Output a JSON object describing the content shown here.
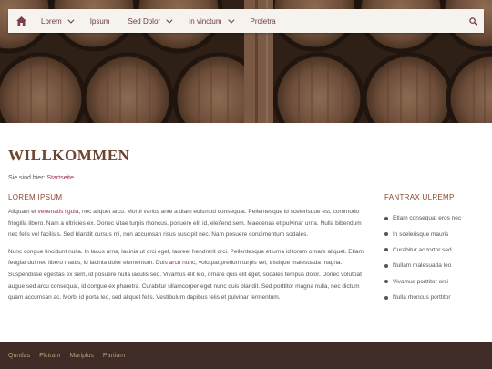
{
  "nav": {
    "items": [
      {
        "label": "Lorem",
        "has_dropdown": true
      },
      {
        "label": "Ipsum",
        "has_dropdown": false
      },
      {
        "label": "Sed Dolor",
        "has_dropdown": true
      },
      {
        "label": "In vinctum",
        "has_dropdown": true
      },
      {
        "label": "Proletra",
        "has_dropdown": false
      }
    ],
    "home_icon": "home-icon",
    "search_icon": "search-icon"
  },
  "page": {
    "title": "WILLKOMMEN",
    "breadcrumb_prefix": "Sie sind hier:",
    "breadcrumb_link": "Startseite"
  },
  "main": {
    "heading": "LOREM IPSUM",
    "p1": {
      "t1": "Aliquam et ",
      "link": "venenatis ligula",
      "t2": ", nec aliquet arcu. Morbi varius ante a diam euismod consequat. Pellentesque id scelerisque est, commodo fringilla libero. Nam a ultricies ex. Donec vitae turpis rhoncus, posuere elit id, eleifend sem. Maecenas et pulvinar urna. Nulla bibendum nec felis vel facilisis. Sed blandit cursus mi, non accumsan risus suscipit nec. Nam posuere condimentum sodales."
    },
    "p2": {
      "t1": "Nunc congue tincidunt nulla. In lacus urna, lacinia ut orci eget, laoreet hendrerit orci. Pellentesque et urna id lorem ornare aliquet. Etiam feugiat dui nec libero mattis, id lacinia dolor elementum. Duis ",
      "link": "arcu nunc",
      "t2": ", volutpat pretium turpis vel, tristique malesuada magna. Suspendisse egestas ex sem, id posuere nulla iaculis sed. Vivamus elit leo, ornare quis elit eget, sodales tempus dolor. Donec volutpat augue sed arcu consequat, id congue ex pharetra. Curabitur ullamcorper eget nunc quis blandit. Sed porttitor magna nulla, nec dictum quam accumsan ac. Morbi id porta leo, sed aliquet felis. Vestibulum dapibus felis et pulvinar fermentum."
    }
  },
  "sidebar": {
    "heading": "FANTRAX ULREMP",
    "items": [
      "Etlam consequat eros nec",
      "In scelerisque mauris",
      "Curabitur ac tortor sed",
      "Nullam malesuada leo",
      "Vivamus porttitor orci",
      "Nulla rhoncus porttitor"
    ]
  },
  "footer": {
    "links": [
      "Quntlas",
      "Flctram",
      "Mariplus",
      "Partium"
    ]
  },
  "colors": {
    "accent": "#9b2a56",
    "heading": "#6e4331",
    "footer_bg": "#3f2c26",
    "nav_bg": "#f6f2ee"
  }
}
